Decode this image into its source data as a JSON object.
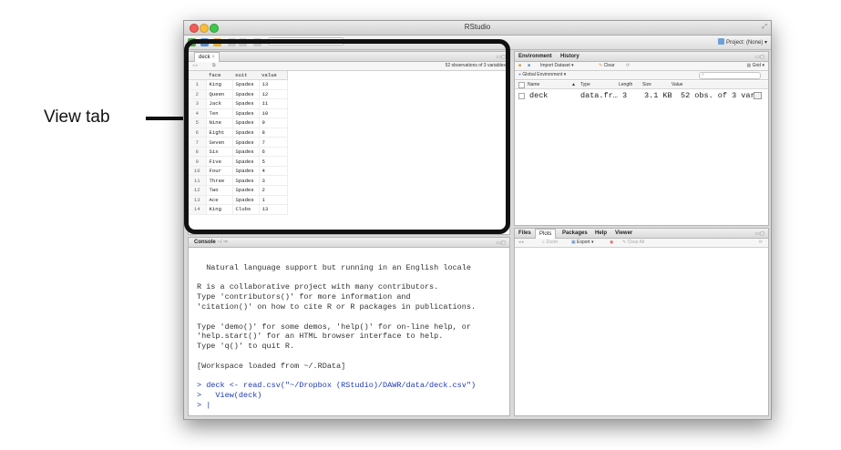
{
  "annotation": {
    "label": "View tab"
  },
  "window": {
    "title": "RStudio"
  },
  "toolbar": {
    "goto_placeholder": "Go to file/function",
    "project": "Project: (None)"
  },
  "source_pane": {
    "tab": "deck",
    "summary": "52 observations of 3 variables",
    "columns": [
      "face",
      "suit",
      "value"
    ],
    "rows": [
      [
        "1",
        "King",
        "Spades",
        "13"
      ],
      [
        "2",
        "Queen",
        "Spades",
        "12"
      ],
      [
        "3",
        "Jack",
        "Spades",
        "11"
      ],
      [
        "4",
        "Ten",
        "Spades",
        "10"
      ],
      [
        "5",
        "Nine",
        "Spades",
        "9"
      ],
      [
        "6",
        "Eight",
        "Spades",
        "8"
      ],
      [
        "7",
        "Seven",
        "Spades",
        "7"
      ],
      [
        "8",
        "Six",
        "Spades",
        "6"
      ],
      [
        "9",
        "Five",
        "Spades",
        "5"
      ],
      [
        "10",
        "Four",
        "Spades",
        "4"
      ],
      [
        "11",
        "Three",
        "Spades",
        "3"
      ],
      [
        "12",
        "Two",
        "Spades",
        "2"
      ],
      [
        "13",
        "Ace",
        "Spades",
        "1"
      ],
      [
        "14",
        "King",
        "Clubs",
        "13"
      ]
    ]
  },
  "env_pane": {
    "tabs": [
      "Environment",
      "History"
    ],
    "import_dataset": "Import Dataset",
    "clear": "Clear",
    "grid": "Grid",
    "scope": "Global Environment",
    "columns": {
      "name": "Name",
      "type": "Type",
      "length": "Length",
      "size": "Size",
      "value": "Value"
    },
    "row": {
      "name": "deck",
      "type": "data.fr…",
      "length": "3",
      "size": "3.1 KB",
      "value": "52 obs. of 3 var…"
    }
  },
  "console_pane": {
    "tab": "Console",
    "path": "~/",
    "lines": [
      "",
      "  Natural language support but running in an English locale",
      "",
      "R is a collaborative project with many contributors.",
      "Type 'contributors()' for more information and",
      "'citation()' on how to cite R or R packages in publications.",
      "",
      "Type 'demo()' for some demos, 'help()' for on-line help, or",
      "'help.start()' for an HTML browser interface to help.",
      "Type 'q()' to quit R.",
      "",
      "[Workspace loaded from ~/.RData]",
      ""
    ],
    "commands": [
      "> deck <- read.csv(\"~/Dropbox (RStudio)/DAWR/data/deck.csv\")",
      ">   View(deck)",
      "> |"
    ]
  },
  "files_pane": {
    "tabs": [
      "Files",
      "Plots",
      "Packages",
      "Help",
      "Viewer"
    ],
    "zoom": "Zoom",
    "export": "Export",
    "clear_all": "Clear All"
  },
  "colors": {
    "command": "#1e39b4",
    "highlight": "#111111"
  }
}
